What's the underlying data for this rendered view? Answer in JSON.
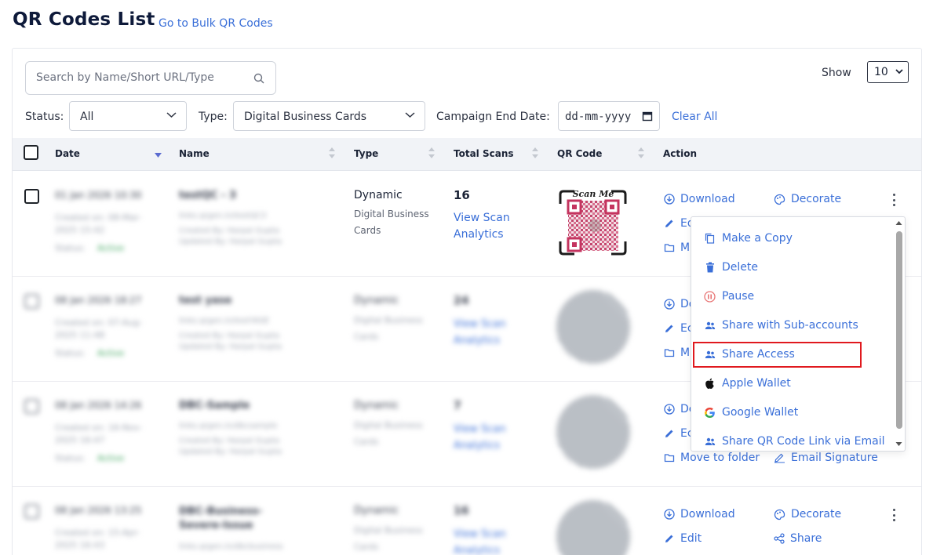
{
  "header": {
    "title": "QR Codes List",
    "bulk_link": "Go to Bulk QR Codes"
  },
  "search": {
    "placeholder": "Search by Name/Short URL/Type"
  },
  "show": {
    "label": "Show",
    "value": "10"
  },
  "filters": {
    "status_label": "Status:",
    "status_value": "All",
    "type_label": "Type:",
    "type_value": "Digital Business Cards",
    "campaign_label": "Campaign End Date:",
    "campaign_value": "dd-mm-yyyy",
    "clear_all": "Clear All"
  },
  "table": {
    "columns": [
      "Date",
      "Name",
      "Type",
      "Total Scans",
      "QR Code",
      "Action"
    ],
    "rows": [
      {
        "date": "01 Jan 2026 10:30",
        "created": "Created on: 08-Mar-2025 15:42",
        "status_label": "Status:",
        "status": "Active",
        "name": "testQC - 3",
        "short_url": "links.qrgen.in/testQC3",
        "created_by": "Created By: Harpal Gupta",
        "updated_by": "Updated By: Harpal Gupta",
        "type": "Dynamic",
        "type_sub": "Digital Business Cards",
        "scans": "16",
        "view_link": "View Scan Analytics",
        "qr_label": "Scan Me"
      },
      {
        "date": "08 Jan 2026 18:27",
        "created": "Created on: 07-Aug-2025 11:48",
        "status_label": "Status:",
        "status": "Active",
        "name": "test yase",
        "short_url": "links.qrgen.in/testYASE",
        "created_by": "Created By: Harpal Gupta",
        "updated_by": "Updated By: Harpal Gupta",
        "type": "Dynamic",
        "type_sub": "Digital Business Cards",
        "scans": "24",
        "view_link": "View Scan Analytics"
      },
      {
        "date": "08 Jan 2026 14:26",
        "created": "Created on: 16-Nov-2025 16:47",
        "status_label": "Status:",
        "status": "Active",
        "name": "DBC-Sample",
        "short_url": "links.qrgen.in/dbcsample",
        "created_by": "Created By: Harpal Gupta",
        "updated_by": "Updated By: Harpal Gupta",
        "type": "Dynamic",
        "type_sub": "Digital Business Cards",
        "scans": "7",
        "view_link": "View Scan Analytics"
      },
      {
        "date": "08 Jan 2026 13:25",
        "created": "Created on: 15-Apr-2025 16:43",
        "status_label": "",
        "status": "",
        "name": "DBC-Business-Severe-Issue",
        "short_url": "links.qrgen.in/dbcbusiness",
        "created_by": "",
        "updated_by": "",
        "type": "Dynamic",
        "type_sub": "Digital Business Cards",
        "scans": "16",
        "view_link": "View Scan Analytics"
      }
    ]
  },
  "actions": {
    "download": "Download",
    "decorate": "Decorate",
    "edit": "Edit",
    "move": "Move to folder",
    "email_signature": "Email Signature",
    "share": "Share",
    "edit_truncated": "Ed",
    "move_truncated": "M",
    "download_truncated": "Do",
    "edit_truncated_2": "Ec",
    "move_truncated_2": "Mi",
    "download_truncated_2": "De"
  },
  "menu": {
    "items": [
      {
        "label": "Make a Copy",
        "icon": "copy-icon"
      },
      {
        "label": "Delete",
        "icon": "trash-icon"
      },
      {
        "label": "Pause",
        "icon": "pause-icon"
      },
      {
        "label": "Share with Sub-accounts",
        "icon": "users-icon"
      },
      {
        "label": "Share Access",
        "icon": "users-icon"
      },
      {
        "label": "Apple Wallet",
        "icon": "apple-icon"
      },
      {
        "label": "Google Wallet",
        "icon": "google-icon"
      },
      {
        "label": "Share QR Code Link via Email",
        "icon": "users-icon"
      }
    ],
    "highlighted": "Share Access"
  },
  "colors": {
    "accent": "#3a6fd8",
    "title": "#0e1a3a",
    "highlight": "#e0191e",
    "active": "#3aa35a",
    "qr_brand": "#d63a6a"
  }
}
